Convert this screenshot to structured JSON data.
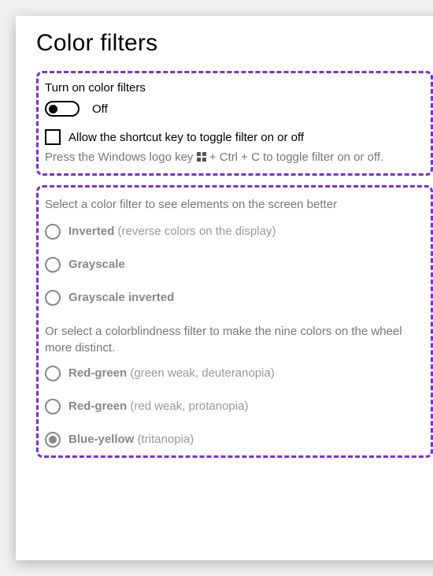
{
  "title": "Color filters",
  "section1": {
    "toggle_label": "Turn on color filters",
    "toggle_state": "Off",
    "checkbox_label": "Allow the shortcut key to toggle filter on or off",
    "help_pre": "Press the Windows logo key ",
    "help_post": " + Ctrl + C to toggle filter on or off."
  },
  "section2": {
    "intro": "Select a color filter to see elements on the screen better",
    "options": [
      {
        "bold": "Inverted",
        "paren": " (reverse colors on the display)",
        "selected": false
      },
      {
        "bold": "Grayscale",
        "paren": "",
        "selected": false
      },
      {
        "bold": "Grayscale inverted",
        "paren": "",
        "selected": false
      }
    ],
    "intro2": "Or select a colorblindness filter to make the nine colors on the wheel more distinct.",
    "options2": [
      {
        "bold": "Red-green",
        "paren": " (green weak, deuteranopia)",
        "selected": false
      },
      {
        "bold": "Red-green",
        "paren": " (red weak, protanopia)",
        "selected": false
      },
      {
        "bold": "Blue-yellow",
        "paren": " (tritanopia)",
        "selected": true
      }
    ]
  }
}
